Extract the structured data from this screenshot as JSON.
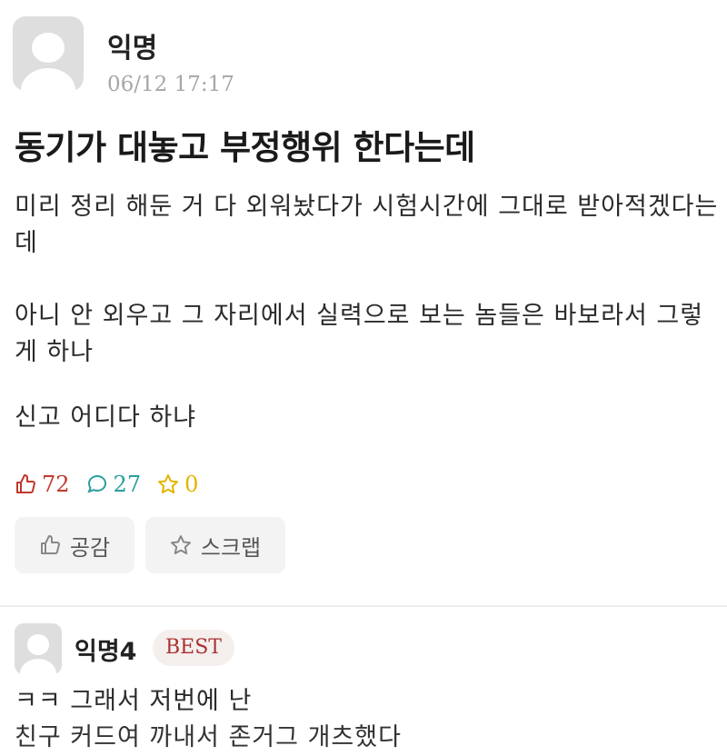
{
  "post": {
    "author": "익명",
    "time": "06/12 17:17",
    "title": "동기가 대놓고 부정행위 한다는데",
    "paragraphs": [
      "미리 정리 해둔 거 다 외워놨다가 시험시간에 그대로 받아적겠다는데",
      "아니 안 외우고 그 자리에서 실력으로 보는 놈들은 바보라서 그렇게 하나",
      "신고 어디다 하냐"
    ],
    "stats": {
      "likes": "72",
      "comments": "27",
      "scraps": "0"
    },
    "buttons": {
      "like_label": "공감",
      "scrap_label": "스크랩"
    }
  },
  "comment": {
    "author": "익명4",
    "badge": "BEST",
    "line1": "ㅋㅋ 그래서 저번에 난",
    "line2": "친구 커드여 까내서 존거그 개츠했다"
  },
  "colors": {
    "like": "#c0392b",
    "comment": "#2a9d9d",
    "scrap": "#e3b400",
    "best_text": "#aa3333"
  }
}
